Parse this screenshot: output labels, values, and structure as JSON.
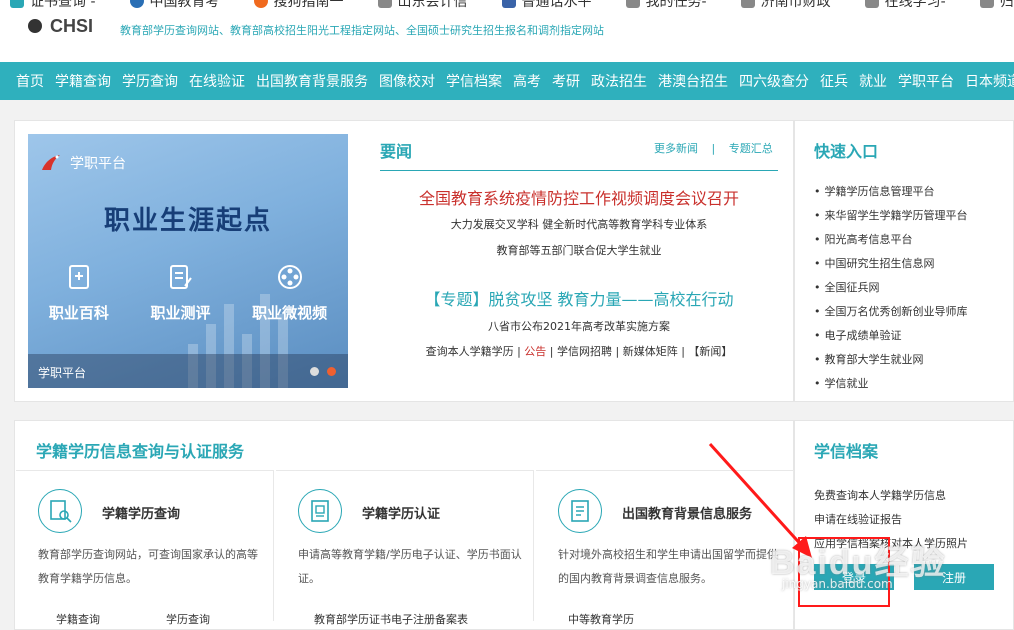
{
  "bookmarks": [
    "证书查询 -",
    "中国教育考",
    "搜狗指南一",
    "山东会计信",
    "普通话水平",
    "我的任务-",
    "济南市财政",
    "在线学习-",
    "归巢业务办"
  ],
  "header": {
    "logo": "CHSI",
    "slogan": "教育部学历查询网站、教育部高校招生阳光工程指定网站、全国硕士研究生招生报名和调剂指定网站"
  },
  "nav": [
    "首页",
    "学籍查询",
    "学历查询",
    "在线验证",
    "出国教育背景服务",
    "图像校对",
    "学信档案",
    "高考",
    "考研",
    "政法招生",
    "港澳台招生",
    "四六级查分",
    "征兵",
    "就业",
    "学职平台",
    "日本频道"
  ],
  "banner": {
    "platform": "学职平台",
    "headline": "职业生涯起点",
    "items": [
      "职业百科",
      "职业测评",
      "职业微视频"
    ],
    "footer": "学职平台"
  },
  "news": {
    "title": "要闻",
    "more": "更多新闻",
    "sep": "|",
    "topics": "专题汇总",
    "headline1": "全国教育系统疫情防控工作视频调度会议召开",
    "sub1": "大力发展交叉学科 健全新时代高等教育学科专业体系",
    "sub2": "教育部等五部门联合促大学生就业",
    "headline2": "【专题】脱贫攻坚 教育力量——高校在行动",
    "sub3": "八省市公布2021年高考改革实施方案",
    "links": {
      "a": "查询本人学籍学历",
      "b": "公告",
      "c": "学信网招聘",
      "d": "新媒体矩阵",
      "e": "【新闻】"
    }
  },
  "quick": {
    "title": "快速入口",
    "items": [
      "学籍学历信息管理平台",
      "来华留学生学籍学历管理平台",
      "阳光高考信息平台",
      "中国研究生招生信息网",
      "全国征兵网",
      "全国万名优秀创新创业导师库",
      "电子成绩单验证",
      "教育部大学生就业网",
      "学信就业"
    ]
  },
  "services": {
    "title": "学籍学历信息查询与认证服务",
    "cards": [
      {
        "name": "学籍学历查询",
        "desc": "教育部学历查询网站，可查询国家承认的高等教育学籍学历信息。",
        "links": [
          "学籍查询",
          "学历查询"
        ]
      },
      {
        "name": "学籍学历认证",
        "desc": "申请高等教育学籍/学历电子认证、学历书面认证。",
        "links": [
          "教育部学历证书电子注册备案表"
        ]
      },
      {
        "name": "出国教育背景信息服务",
        "desc": "针对境外高校招生和学生申请出国留学而提供的国内教育背景调查信息服务。",
        "links": [
          "中等教育学历"
        ]
      }
    ]
  },
  "archive": {
    "title": "学信档案",
    "items": [
      "免费查询本人学籍学历信息",
      "申请在线验证报告",
      "应用学信档案核对本人学历照片"
    ],
    "login": "登录",
    "register": "注册"
  },
  "watermark": {
    "main": "Baidu经验",
    "sub": "jingyan.baidu.com"
  },
  "colors": {
    "accent": "#2fb0bd",
    "highlight": "#ff1a1a",
    "headline": "#c9302c"
  }
}
